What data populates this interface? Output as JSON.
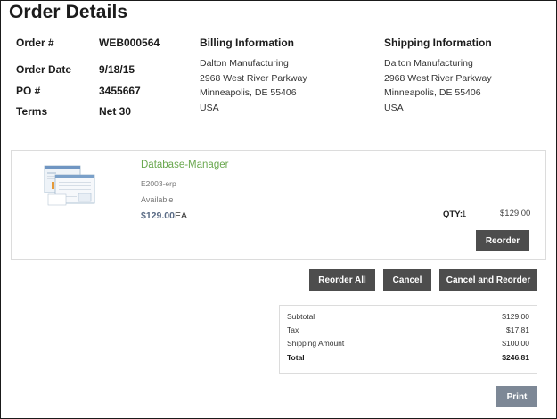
{
  "page": {
    "title": "Order Details"
  },
  "order": {
    "number_label": "Order #",
    "number": "WEB000564",
    "date_label": "Order Date",
    "date": "9/18/15",
    "po_label": "PO #",
    "po": "3455667",
    "terms_label": "Terms",
    "terms": "Net 30"
  },
  "billing": {
    "heading": "Billing Information",
    "lines": [
      "Dalton Manufacturing",
      "2968 West River Parkway",
      "Minneapolis, DE 55406",
      "USA"
    ]
  },
  "shipping": {
    "heading": "Shipping Information",
    "lines": [
      "Dalton Manufacturing",
      "2968 West River Parkway",
      "Minneapolis, DE 55406",
      "USA"
    ]
  },
  "item": {
    "name": "Database-Manager",
    "sku": "E2003-erp",
    "availability": "Available",
    "price": "$129.00",
    "uom": "EA",
    "qty_label": "QTY:",
    "qty": "1",
    "line_total": "$129.00",
    "reorder_label": "Reorder",
    "thumbnail_icon": "product-screenshot-icon"
  },
  "actions": {
    "reorder_all": "Reorder All",
    "cancel": "Cancel",
    "cancel_and_reorder": "Cancel and Reorder"
  },
  "totals": {
    "subtotal_label": "Subtotal",
    "subtotal": "$129.00",
    "tax_label": "Tax",
    "tax": "$17.81",
    "shipping_label": "Shipping Amount",
    "shipping": "$100.00",
    "total_label": "Total",
    "total": "$246.81"
  },
  "print_label": "Print",
  "colors": {
    "button": "#4d4d4d",
    "print_button": "#7d8896",
    "product_link": "#6aa84f",
    "price": "#5a6b85"
  }
}
